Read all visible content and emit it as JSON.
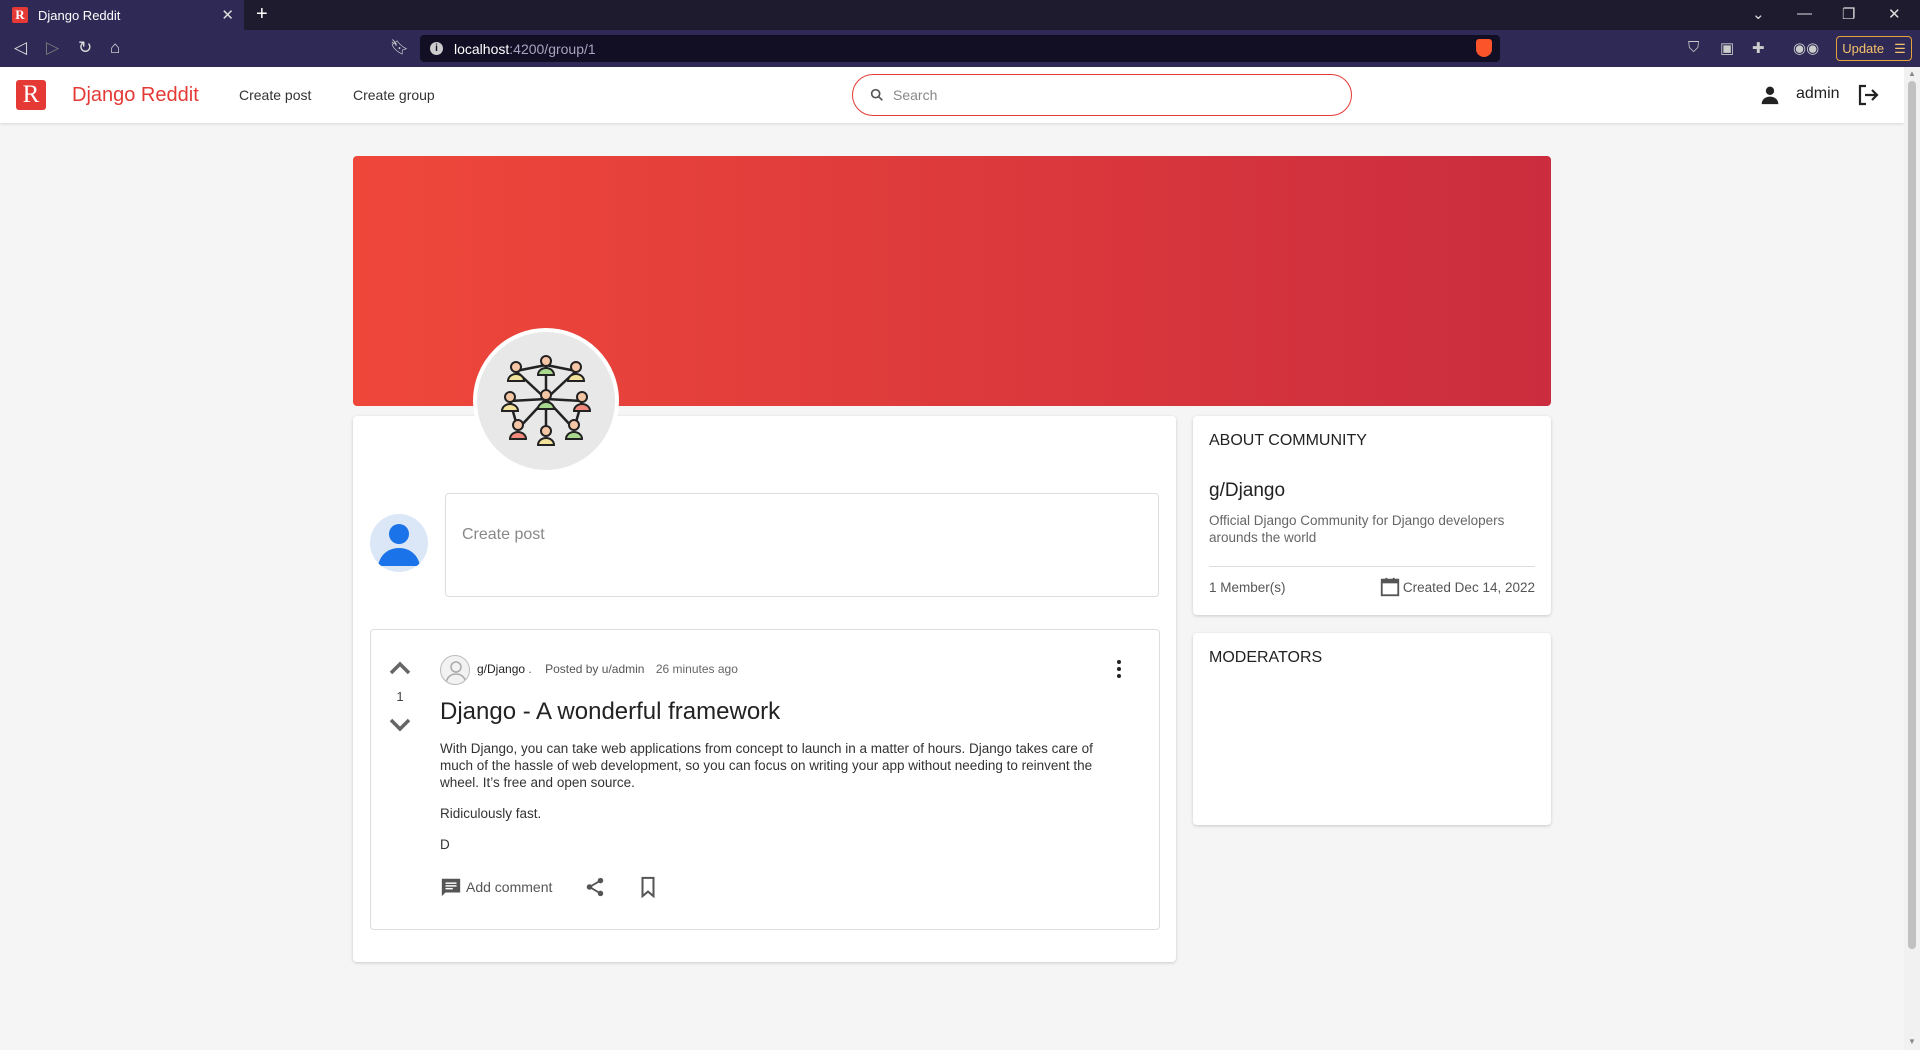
{
  "browser": {
    "tab_title": "Django Reddit",
    "tab_favicon": "R",
    "url_host": "localhost",
    "url_path": ":4200/group/1",
    "update_label": "Update"
  },
  "header": {
    "logo_letter": "R",
    "brand": "Django Reddit",
    "nav": [
      "Create post",
      "Create group"
    ],
    "search_placeholder": "Search",
    "username": "admin",
    "accent_color": "#e53935"
  },
  "group": {
    "avatar_icon": "community-network-icon"
  },
  "composer": {
    "placeholder": "Create post"
  },
  "post": {
    "votes": "1",
    "group": "g/Django",
    "group_suffix": " .",
    "posted_by": "Posted by u/admin",
    "time": "26 minutes ago",
    "title": "Django - A wonderful framework",
    "body": [
      "With Django, you can take web applications from concept to launch in a matter of hours. Django takes care of much of the hassle of web development, so you can focus on writing your app without needing to reinvent the wheel. It’s free and open source.",
      "Ridiculously fast.",
      "D"
    ],
    "add_comment": "Add comment"
  },
  "about": {
    "heading": "ABOUT COMMUNITY",
    "group_name": "g/Django",
    "description": "Official Django Community for Django developers arounds the world",
    "members": "1 Member(s)",
    "created": "Created Dec 14, 2022"
  },
  "moderators": {
    "heading": "MODERATORS"
  }
}
